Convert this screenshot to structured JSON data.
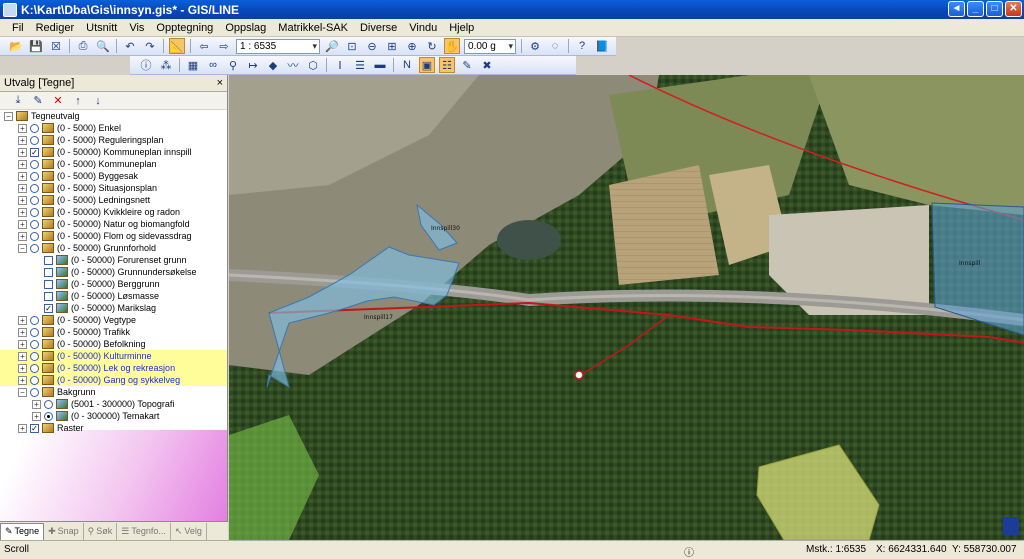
{
  "window": {
    "title": "K:\\Kart\\Dba\\Gis\\innsyn.gis* - GIS/LINE",
    "buttons": [
      "◄",
      "_",
      "□",
      "✕"
    ]
  },
  "menu": [
    "Fil",
    "Rediger",
    "Utsnitt",
    "Vis",
    "Opptegning",
    "Oppslag",
    "Matrikkel-SAK",
    "Diverse",
    "Vindu",
    "Hjelp"
  ],
  "toolbar": {
    "scale_value": "1 : 6535",
    "offset_value": "0.00 g"
  },
  "panel": {
    "title": "Utvalg [Tegne]",
    "close": "×",
    "tree": [
      {
        "label": "Tegneutvalg",
        "level": 0
      },
      {
        "label": "(0 - 5000) Enkel",
        "level": 1
      },
      {
        "label": "(0 - 5000) Reguleringsplan",
        "level": 1
      },
      {
        "label": "(0 - 50000) Kommuneplan innspill",
        "level": 1,
        "checked": true
      },
      {
        "label": "(0 - 5000) Kommuneplan",
        "level": 1
      },
      {
        "label": "(0 - 5000) Byggesak",
        "level": 1
      },
      {
        "label": "(0 - 5000) Situasjonsplan",
        "level": 1
      },
      {
        "label": "(0 - 5000) Ledningsnett",
        "level": 1
      },
      {
        "label": "(0 - 50000) Kvikkleire og radon",
        "level": 1
      },
      {
        "label": "(0 - 50000) Natur og biomangfold",
        "level": 1
      },
      {
        "label": "(0 - 50000) Flom og sidevassdrag",
        "level": 1
      },
      {
        "label": "(0 - 50000) Grunnforhold",
        "level": 1
      },
      {
        "label": "(0 - 50000) Forurenset grunn",
        "level": 2
      },
      {
        "label": "(0 - 50000) Grunnundersøkelse",
        "level": 2
      },
      {
        "label": "(0 - 50000) Berggrunn",
        "level": 2
      },
      {
        "label": "(0 - 50000) Løsmasse",
        "level": 2
      },
      {
        "label": "(0 - 50000) Marikslag",
        "level": 2,
        "checked": true
      },
      {
        "label": "(0 - 50000) Vegtype",
        "level": 1
      },
      {
        "label": "(0 - 50000) Trafikk",
        "level": 1
      },
      {
        "label": "(0 - 50000) Befolkning",
        "level": 1
      },
      {
        "label": "(0 - 50000) Kulturminne",
        "level": 1,
        "blue": true,
        "highlight": true
      },
      {
        "label": "(0 - 50000) Lek og rekreasjon",
        "level": 1,
        "blue": true,
        "highlight": true
      },
      {
        "label": "(0 - 50000) Gang og sykkelveg",
        "level": 1,
        "blue": true,
        "highlight": true
      },
      {
        "label": "Bakgrunn",
        "level": 1
      },
      {
        "label": "(5001 - 300000) Topografi",
        "level": 2
      },
      {
        "label": "(0 - 300000) Temakart",
        "level": 2,
        "radio_on": true
      },
      {
        "label": "Raster",
        "level": 1,
        "checked": true
      }
    ],
    "tabs": [
      "Tegne",
      "Snap",
      "Søk",
      "Tegnfo...",
      "Velg"
    ]
  },
  "map": {
    "labels": [
      "Innspill30",
      "Innspill17",
      "Innspill"
    ]
  },
  "status": {
    "mode": "Scroll",
    "scale": "Mstk.: 1:6535",
    "x": "X:  6624331.640",
    "y": "Y:  558730.007"
  }
}
